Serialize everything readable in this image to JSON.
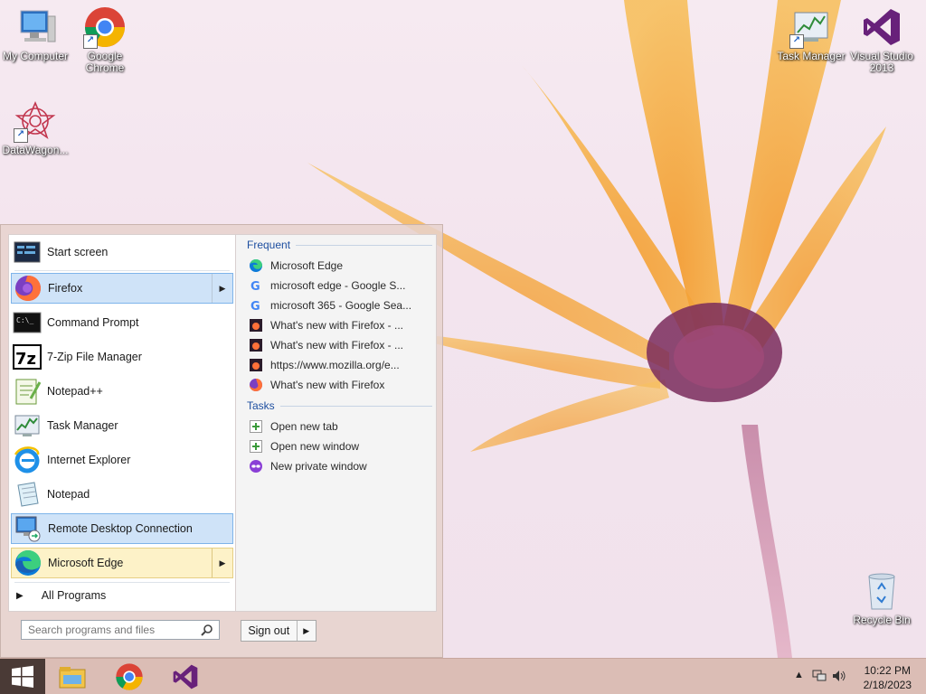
{
  "desktop": {
    "icons": [
      {
        "label": "My Computer"
      },
      {
        "label": "Google Chrome"
      },
      {
        "label": "DataWagon..."
      },
      {
        "label": "Task Manager"
      },
      {
        "label": "Visual Studio 2013"
      },
      {
        "label": "Recycle Bin"
      }
    ]
  },
  "start_menu": {
    "programs": [
      {
        "label": "Start screen",
        "icon": "start-screen-icon"
      },
      {
        "label": "Firefox",
        "icon": "firefox-icon",
        "state": "highlighted"
      },
      {
        "label": "Command Prompt",
        "icon": "command-prompt-icon"
      },
      {
        "label": "7-Zip File Manager",
        "icon": "7zip-icon"
      },
      {
        "label": "Notepad++",
        "icon": "notepadpp-icon"
      },
      {
        "label": "Task Manager",
        "icon": "task-manager-icon"
      },
      {
        "label": "Internet Explorer",
        "icon": "internet-explorer-icon"
      },
      {
        "label": "Notepad",
        "icon": "notepad-icon"
      },
      {
        "label": "Remote Desktop Connection",
        "icon": "remote-desktop-icon",
        "state": "highlighted"
      },
      {
        "label": "Microsoft Edge",
        "icon": "edge-icon",
        "state": "hover"
      }
    ],
    "all_programs_label": "All Programs",
    "search_placeholder": "Search programs and files",
    "signout_label": "Sign out",
    "jump_list": {
      "frequent_title": "Frequent",
      "frequent": [
        {
          "label": "Microsoft Edge",
          "icon": "edge-icon"
        },
        {
          "label": "microsoft edge - Google S...",
          "icon": "google-icon"
        },
        {
          "label": "microsoft 365 - Google Sea...",
          "icon": "google-icon"
        },
        {
          "label": "What's new with Firefox - ...",
          "icon": "firefox-page-icon"
        },
        {
          "label": "What's new with Firefox - ...",
          "icon": "firefox-page-icon"
        },
        {
          "label": "https://www.mozilla.org/e...",
          "icon": "firefox-page-icon"
        },
        {
          "label": "What's new with Firefox",
          "icon": "firefox-icon"
        }
      ],
      "tasks_title": "Tasks",
      "tasks": [
        {
          "label": "Open new tab",
          "icon": "new-tab-icon"
        },
        {
          "label": "Open new window",
          "icon": "new-window-icon"
        },
        {
          "label": "New private window",
          "icon": "private-window-icon"
        }
      ]
    }
  },
  "taskbar": {
    "apps": [
      "file-explorer-icon",
      "chrome-icon",
      "visual-studio-icon"
    ],
    "clock_time": "10:22 PM",
    "clock_date": "2/18/2023"
  },
  "colors": {
    "accent_blue": "#cfe3f8",
    "hover_yellow": "#fdf2c8",
    "section_title": "#1e4fa0",
    "taskbar": "#dbbdb5"
  }
}
